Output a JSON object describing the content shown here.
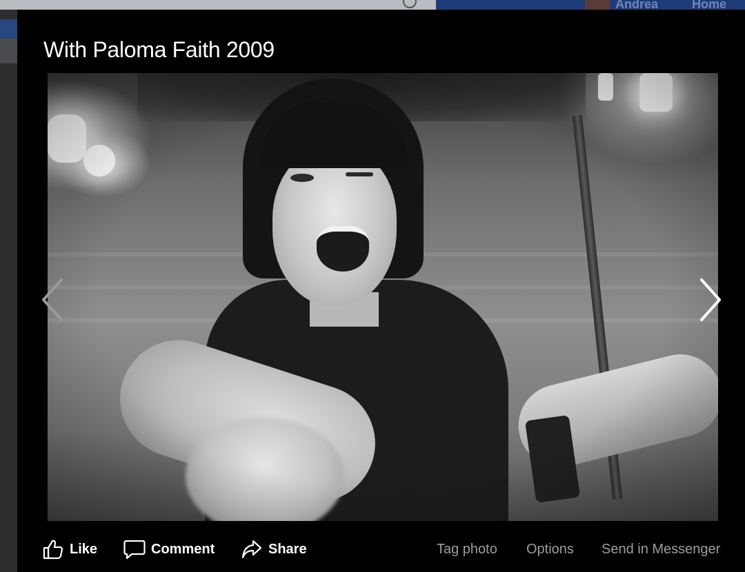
{
  "background": {
    "profile_name": "Andrea",
    "home_label": "Home"
  },
  "lightbox": {
    "title": "With Paloma Faith 2009",
    "photo_alt": "Black and white photo of a smiling, winking woman with a dark bob haircut reaching toward the camera"
  },
  "actions": {
    "like_label": "Like",
    "comment_label": "Comment",
    "share_label": "Share",
    "tag_label": "Tag photo",
    "options_label": "Options",
    "messenger_label": "Send in Messenger"
  },
  "icons": {
    "prev": "chevron-left-icon",
    "next": "chevron-right-icon",
    "like": "thumbs-up-icon",
    "comment": "speech-bubble-icon",
    "share": "share-arrow-icon",
    "search": "search-icon"
  },
  "colors": {
    "lightbox_bg": "#000000",
    "title_text": "#ffffff",
    "secondary_text": "#9a9da3",
    "topbar_blue": "#1d3b77"
  }
}
